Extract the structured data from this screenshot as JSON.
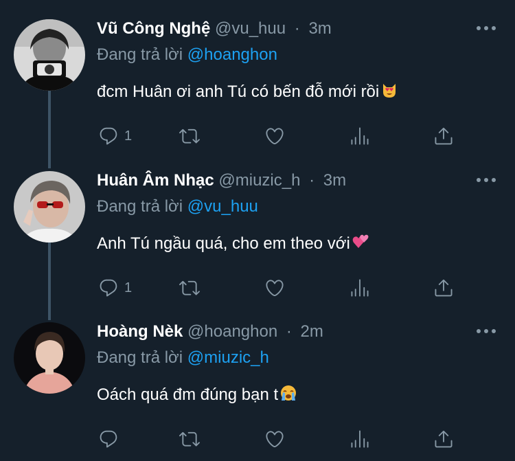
{
  "tweets": [
    {
      "name": "Vũ Công Nghệ",
      "handle": "@vu_huu",
      "time": "3m",
      "reply_prefix": "Đang trả lời",
      "reply_to": "@hoanghon",
      "text": "đcm Huân ơi anh Tú có bến đỗ mới rồi",
      "emoji": "heart-eyes-cat",
      "reply_count": "1"
    },
    {
      "name": "Huân Âm Nhạc",
      "handle": "@miuzic_h",
      "time": "3m",
      "reply_prefix": "Đang trả lời",
      "reply_to": "@vu_huu",
      "text": "Anh Tú ngầu quá, cho em theo với",
      "emoji": "two-hearts",
      "reply_count": "1"
    },
    {
      "name": "Hoàng Nèk",
      "handle": "@hoanghon",
      "time": "2m",
      "reply_prefix": "Đang trả lời",
      "reply_to": "@miuzic_h",
      "text": "Oách quá đm đúng bạn t",
      "emoji": "crying-face",
      "reply_count": ""
    }
  ],
  "separator": "·",
  "colors": {
    "background": "#15202b",
    "secondary_text": "#8899a6",
    "mention": "#1da1f2",
    "thread_line": "#3d5466"
  },
  "icons": [
    "comment-icon",
    "retweet-icon",
    "like-icon",
    "analytics-icon",
    "share-icon",
    "more-icon"
  ]
}
